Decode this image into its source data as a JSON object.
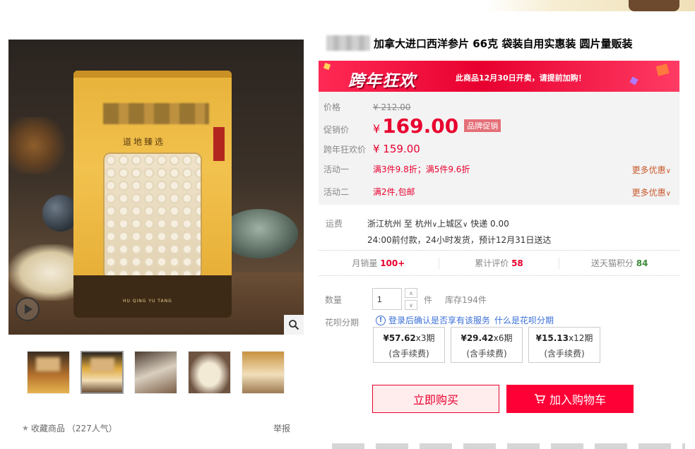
{
  "product": {
    "title": "加拿大进口西洋参片 66克 袋装自用实惠装 圆片量贩装"
  },
  "banner": {
    "main": "跨年狂欢",
    "note": "此商品12月30日开卖，请提前加购！"
  },
  "price": {
    "original_label": "价格",
    "original_value": "¥ 212.00",
    "promo_label": "促销价",
    "promo_currency": "¥",
    "promo_value": "169.00",
    "promo_tag": "品牌促销",
    "festival_label": "跨年狂欢价",
    "festival_value": "¥ 159.00"
  },
  "activities": [
    {
      "label": "活动一",
      "text": "满3件9.8折；满5件9.6折",
      "more": "更多优惠"
    },
    {
      "label": "活动二",
      "text": "满2件,包邮",
      "more": "更多优惠"
    }
  ],
  "shipping": {
    "label": "运费",
    "from": "浙江杭州",
    "to_word": "至",
    "city": "杭州",
    "district": "上城区",
    "method": "快递 0.00",
    "delivery_note": "24:00前付款，24小时发货，预计12月31日送达"
  },
  "stats": [
    {
      "label": "月销量",
      "value": "100+"
    },
    {
      "label": "累计评价",
      "value": "58"
    },
    {
      "label": "送天猫积分",
      "value": "84"
    }
  ],
  "quantity": {
    "label": "数量",
    "value": "1",
    "unit": "件",
    "stock": "库存194件"
  },
  "huabei": {
    "label": "花呗分期",
    "info": "登录后确认是否享有该服务",
    "link": "什么是花呗分期",
    "options": [
      {
        "amount": "¥57.62",
        "periods": "x3期",
        "fee": "(含手续费)"
      },
      {
        "amount": "¥29.42",
        "periods": "x6期",
        "fee": "(含手续费)"
      },
      {
        "amount": "¥15.13",
        "periods": "x12期",
        "fee": "(含手续费)"
      }
    ]
  },
  "actions": {
    "buy": "立即购买",
    "cart": "加入购物车"
  },
  "gallery": {
    "bag_brand": "道地臻选",
    "bag_bottom": "HU QING YU TANG",
    "favorite": "收藏商品",
    "popularity": "（227人气）",
    "report": "举报"
  },
  "icons": {
    "play": "play-icon",
    "zoom": "magnifier-icon",
    "star": "star-icon",
    "cart": "cart-icon",
    "info": "info-icon",
    "chevron": "chevron-down-icon"
  },
  "colors": {
    "accent": "#e8002f",
    "link": "#3a6fd8",
    "cart_button": "#ff0036",
    "points": "#3c8b3c"
  }
}
